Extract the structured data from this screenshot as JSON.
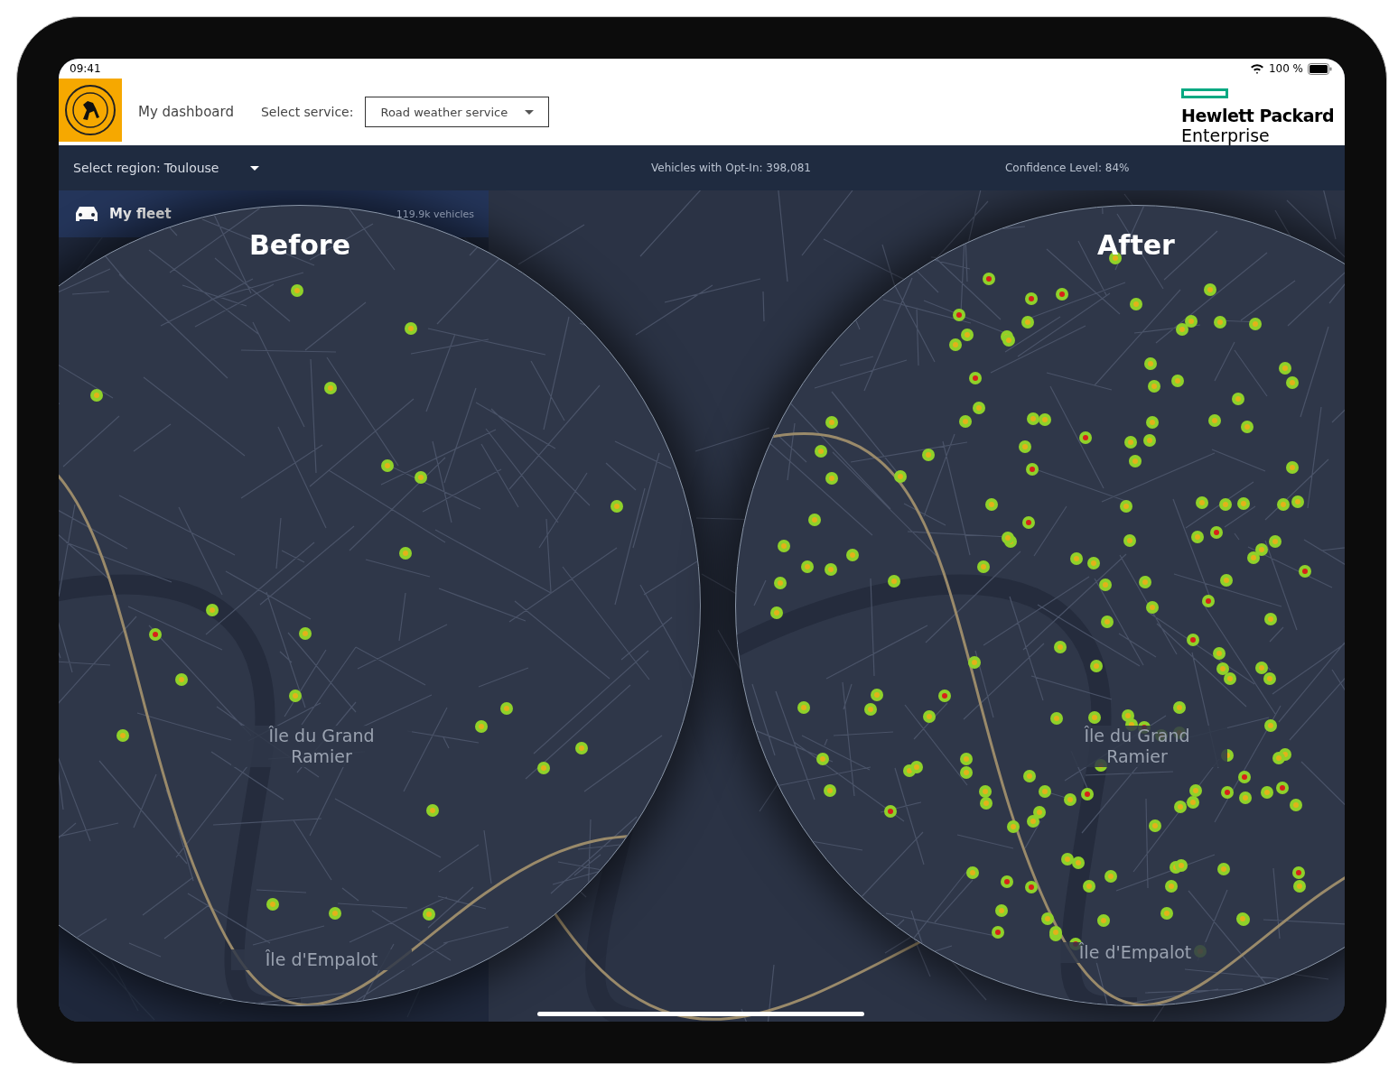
{
  "status_bar": {
    "time": "09:41",
    "battery": "100 %"
  },
  "header": {
    "dashboard_link": "My dashboard",
    "service_label": "Select service:",
    "service_value": "Road weather service"
  },
  "brand": {
    "line_1": "Hewlett Packard",
    "line_2": "Enterprise"
  },
  "region_bar": {
    "label": "Select region:",
    "value": "Toulouse",
    "vehicles": "Vehicles with Opt-In: 398,081",
    "confidence": "Confidence Level: 84%"
  },
  "sidebar": {
    "items": [
      {
        "label": "My fleet",
        "count": "119.9k vehicles",
        "selected": true
      }
    ]
  },
  "lenses": [
    {
      "title": "Before",
      "kind": "sparse",
      "labels": [
        "Île du Grand\nRamier",
        "Île d'Empalot"
      ]
    },
    {
      "title": "After",
      "kind": "dense",
      "labels": [
        "Île du Grand\nRamier",
        "Île d'Empalot"
      ]
    }
  ]
}
